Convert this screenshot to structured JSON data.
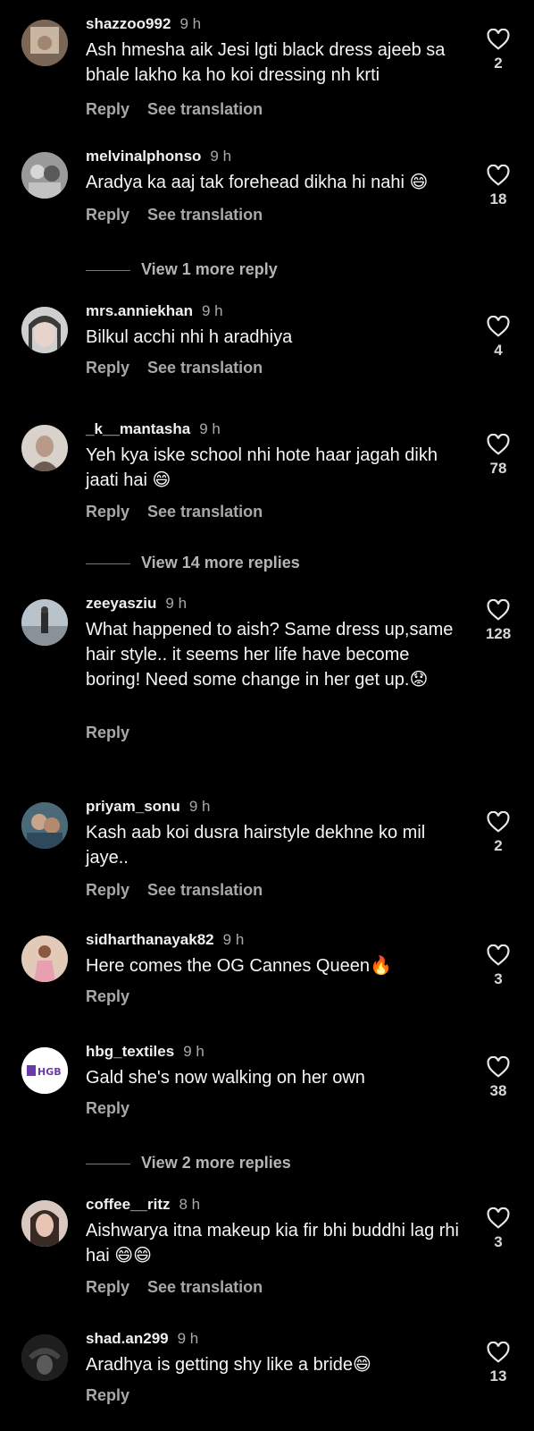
{
  "comments": [
    {
      "username": "shazzoo992",
      "time": "9 h",
      "text": "Ash hmesha aik Jesi lgti black dress ajeeb sa bhale lakho ka ho koi dressing nh krti",
      "likes": "2",
      "reply": "Reply",
      "translate": "See translation"
    },
    {
      "username": "melvinalphonso",
      "time": "9 h",
      "text": "Aradya ka aaj tak forehead dikha hi nahi 😄",
      "likes": "18",
      "reply": "Reply",
      "translate": "See translation"
    },
    {
      "username": "mrs.anniekhan",
      "time": "9 h",
      "text": "Bilkul acchi nhi h aradhiya",
      "likes": "4",
      "reply": "Reply",
      "translate": "See translation"
    },
    {
      "username": "_k__mantasha",
      "time": "9 h",
      "text": "Yeh kya iske school nhi hote haar jagah dikh jaati hai 😄",
      "likes": "78",
      "reply": "Reply",
      "translate": "See translation"
    },
    {
      "username": "zeeyasziu",
      "time": "9 h",
      "text": "What happened to aish? Same dress up,same hair style.. it seems her life have become boring! Need some change in her get up.😟",
      "likes": "128",
      "reply": "Reply",
      "translate": ""
    },
    {
      "username": "priyam_sonu",
      "time": "9 h",
      "text": "Kash aab koi dusra hairstyle dekhne ko mil jaye..",
      "likes": "2",
      "reply": "Reply",
      "translate": "See translation"
    },
    {
      "username": "sidharthanayak82",
      "time": "9 h",
      "text": "Here comes the OG Cannes Queen🔥",
      "likes": "3",
      "reply": "Reply",
      "translate": ""
    },
    {
      "username": "hbg_textiles",
      "time": "9 h",
      "text": "Gald she's now walking on her own",
      "likes": "38",
      "reply": "Reply",
      "translate": ""
    },
    {
      "username": "coffee__ritz",
      "time": "8 h",
      "text": "Aishwarya itna makeup kia fir bhi buddhi lag rhi hai 😄😄",
      "likes": "3",
      "reply": "Reply",
      "translate": "See translation"
    },
    {
      "username": "shad.an299",
      "time": "9 h",
      "text": "Aradhya is getting shy like a bride😄",
      "likes": "13",
      "reply": "Reply",
      "translate": ""
    }
  ],
  "view_more": [
    {
      "label": "View 1 more reply"
    },
    {
      "label": "View 14 more replies"
    },
    {
      "label": "View 2 more replies"
    }
  ],
  "avatar_logo_text": "HGB",
  "colors": {
    "background": "#000000",
    "text": "#f5f5f5",
    "secondary": "#a8a8a8"
  }
}
